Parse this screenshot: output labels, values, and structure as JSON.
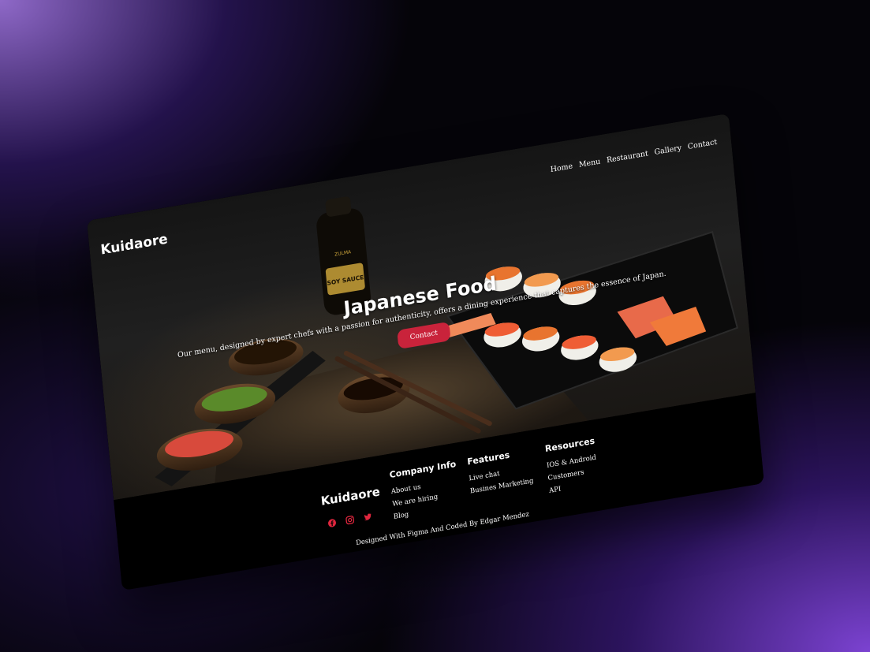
{
  "brand": {
    "name": "Kuidaore"
  },
  "nav": {
    "items": [
      "Home",
      "Menu",
      "Restaurant",
      "Gallery",
      "Contact"
    ]
  },
  "hero": {
    "title": "Japanese Food",
    "subtitle": "Our menu, designed by expert chefs with a passion for authenticity, offers a dining experience that captures the essence of Japan.",
    "cta_label": "Contact",
    "bottle_label": "SOY SAUCE",
    "bottle_brand": "ZULMA"
  },
  "footer": {
    "brand": "Kuidaore",
    "socials": [
      "facebook-icon",
      "instagram-icon",
      "twitter-icon"
    ],
    "columns": [
      {
        "title": "Company Info",
        "links": [
          "About us",
          "We are hiring",
          "Blog"
        ]
      },
      {
        "title": "Features",
        "links": [
          "Live chat",
          "Busines Marketing"
        ]
      },
      {
        "title": "Resources",
        "links": [
          "IOS & Android",
          "Customers",
          "API"
        ]
      }
    ],
    "credit": "Designed With Figma And Coded By Edgar Mendez"
  },
  "colors": {
    "accent": "#c9233b",
    "social": "#e0263e",
    "background": "#050409"
  }
}
